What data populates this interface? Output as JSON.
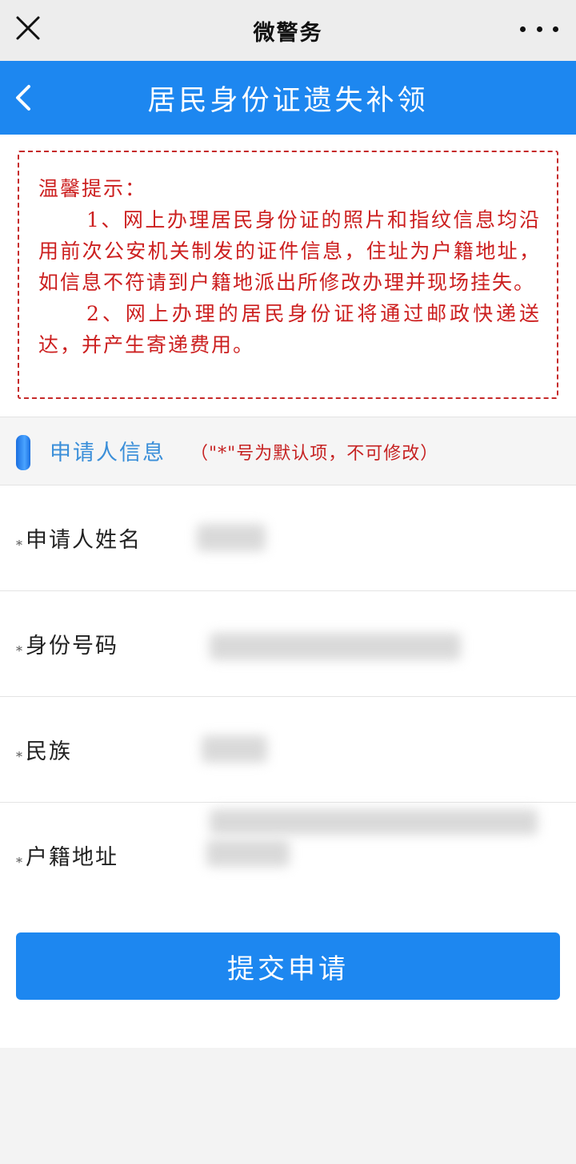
{
  "wechat_bar": {
    "title": "微警务"
  },
  "header": {
    "title": "居民身份证遗失补领"
  },
  "notice": {
    "title": "温馨提示：",
    "items": [
      "1、网上办理居民身份证的照片和指纹信息均沿用前次公安机关制发的证件信息，住址为户籍地址，如信息不符请到户籍地派出所修改办理并现场挂失。",
      "2、网上办理的居民身份证将通过邮政快递送达，并产生寄递费用。"
    ]
  },
  "section": {
    "title": "申请人信息",
    "note": "（\"*\"号为默认项，不可修改）"
  },
  "form": {
    "fields": [
      {
        "star": "*",
        "label": "申请人姓名"
      },
      {
        "star": "*",
        "label": "身份号码"
      },
      {
        "star": "*",
        "label": "民族"
      },
      {
        "star": "*",
        "label": "户籍地址"
      }
    ]
  },
  "actions": {
    "submit_label": "提交申请"
  },
  "colors": {
    "primary": "#1d87f0",
    "notice_red": "#cc1f1f",
    "section_blue": "#3b8fd9"
  },
  "icons": {
    "close": "close-icon",
    "more": "more-dots-icon",
    "back": "chevron-left-icon"
  }
}
